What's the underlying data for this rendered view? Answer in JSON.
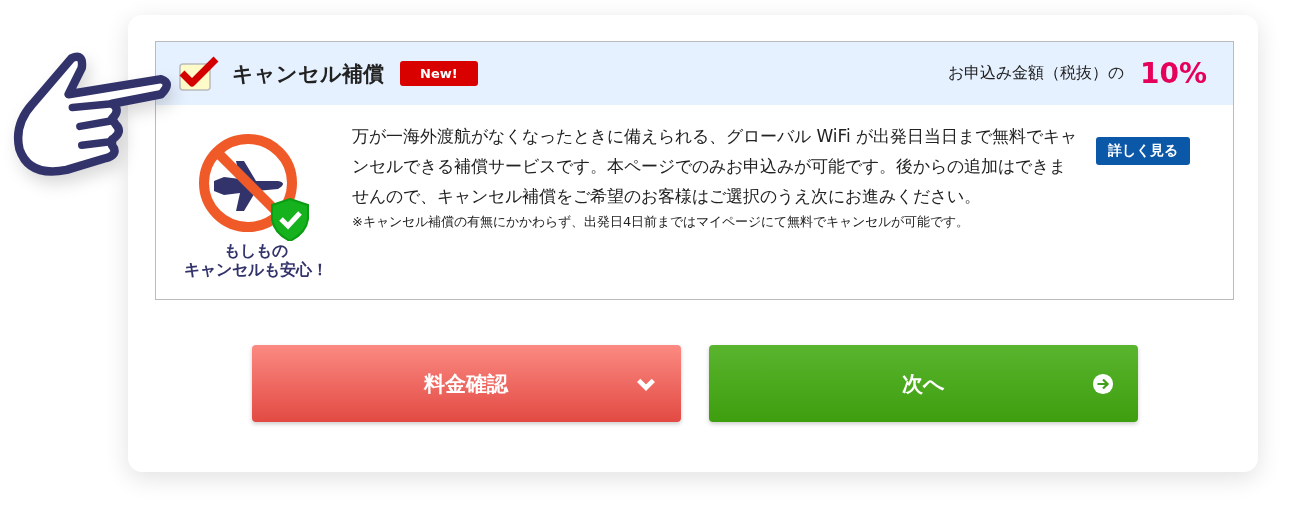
{
  "option": {
    "checked": true,
    "title": "キャンセル補償",
    "badge": "New!",
    "rate_label": "お申込み金額（税抜）の",
    "rate": "10%"
  },
  "illustration": {
    "caption_lines": [
      "もしもの",
      "キャンセルも安心！"
    ]
  },
  "description": "万が一海外渡航がなくなったときに備えられる、グローバル WiFi が出発日当日まで無料でキャンセルできる補償サービスです。本ページでのみお申込みが可能です。後からの追加はできませんので、キャンセル補償をご希望のお客様はご選択のうえ次にお進みください。",
  "note": "※キャンセル補償の有無にかかわらず、出発日4日前まではマイページにて無料でキャンセルが可能です。",
  "details_button": "詳しく見る",
  "buttons": [
    {
      "label": "料金確認",
      "kind": "dropdown"
    },
    {
      "label": "次へ",
      "kind": "next"
    }
  ]
}
